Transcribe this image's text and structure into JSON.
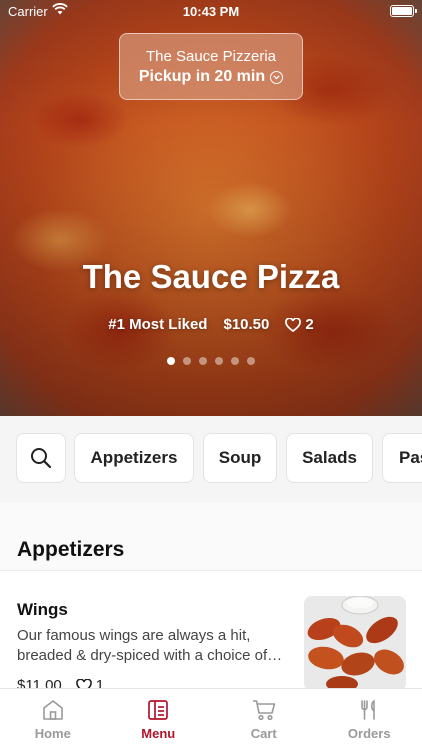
{
  "status_bar": {
    "carrier": "Carrier",
    "time": "10:43 PM"
  },
  "store": {
    "name": "The Sauce Pizzeria",
    "pickup": "Pickup in 20 min"
  },
  "hero": {
    "title": "The Sauce Pizza",
    "badge": "#1 Most Liked",
    "price": "$10.50",
    "likes": "2",
    "slides": 6,
    "active_slide": 0
  },
  "categories": [
    "Appetizers",
    "Soup",
    "Salads",
    "Pas"
  ],
  "section": {
    "title": "Appetizers"
  },
  "items": [
    {
      "name": "Wings",
      "description": "Our famous wings are always a hit, breaded & dry-spiced with a choice of…",
      "price": "$11.00",
      "likes": "1"
    }
  ],
  "tabs": [
    {
      "label": "Home",
      "icon": "home-icon"
    },
    {
      "label": "Menu",
      "icon": "menu-icon",
      "active": true
    },
    {
      "label": "Cart",
      "icon": "cart-icon"
    },
    {
      "label": "Orders",
      "icon": "orders-icon"
    }
  ],
  "colors": {
    "accent": "#b3142a",
    "tab_inactive": "#9a9a9a",
    "background": "#f5f5f5"
  }
}
